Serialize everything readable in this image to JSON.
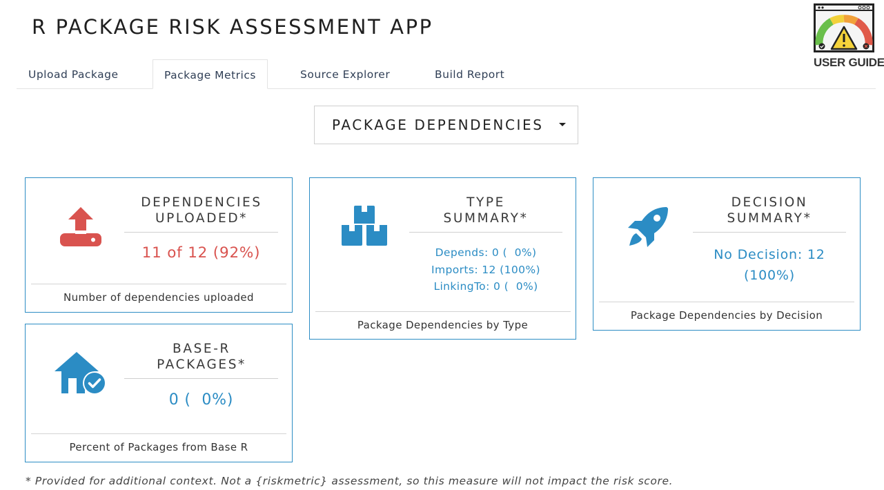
{
  "app": {
    "title": "R PACKAGE RISK ASSESSMENT APP"
  },
  "user_guide": {
    "label": "USER GUIDE"
  },
  "tabs": [
    {
      "label": "Upload Package",
      "active": false
    },
    {
      "label": "Package Metrics",
      "active": true
    },
    {
      "label": "Source Explorer",
      "active": false
    },
    {
      "label": "Build Report",
      "active": false
    }
  ],
  "metric_selector": {
    "selected": "PACKAGE DEPENDENCIES"
  },
  "cards": {
    "dependencies_uploaded": {
      "icon": "upload-icon",
      "title_line1": "DEPENDENCIES",
      "title_line2": "UPLOADED*",
      "value": "11 of 12 (92%)",
      "footer": "Number of dependencies uploaded"
    },
    "type_summary": {
      "icon": "boxes-icon",
      "title_line1": "TYPE",
      "title_line2": "SUMMARY*",
      "lines": [
        "Depends: 0 (  0%)",
        "Imports: 12 (100%)",
        "LinkingTo: 0 (  0%)"
      ],
      "footer": "Package Dependencies by Type"
    },
    "decision_summary": {
      "icon": "rocket-icon",
      "title_line1": "DECISION",
      "title_line2": "SUMMARY*",
      "value_line1": "No Decision: 12",
      "value_line2": "(100%)",
      "footer": "Package Dependencies by Decision"
    },
    "base_r_packages": {
      "icon": "house-check-icon",
      "title_line1": "BASE-R",
      "title_line2": "PACKAGES*",
      "value": "0 (  0%)",
      "footer": "Percent of Packages from Base R"
    }
  },
  "footnote": "* Provided for additional context. Not a {riskmetric} assessment, so this measure will not impact the risk score.",
  "colors": {
    "accent": "#2b8cc4",
    "warning": "#d9534f",
    "border": "#2b8cc4"
  }
}
